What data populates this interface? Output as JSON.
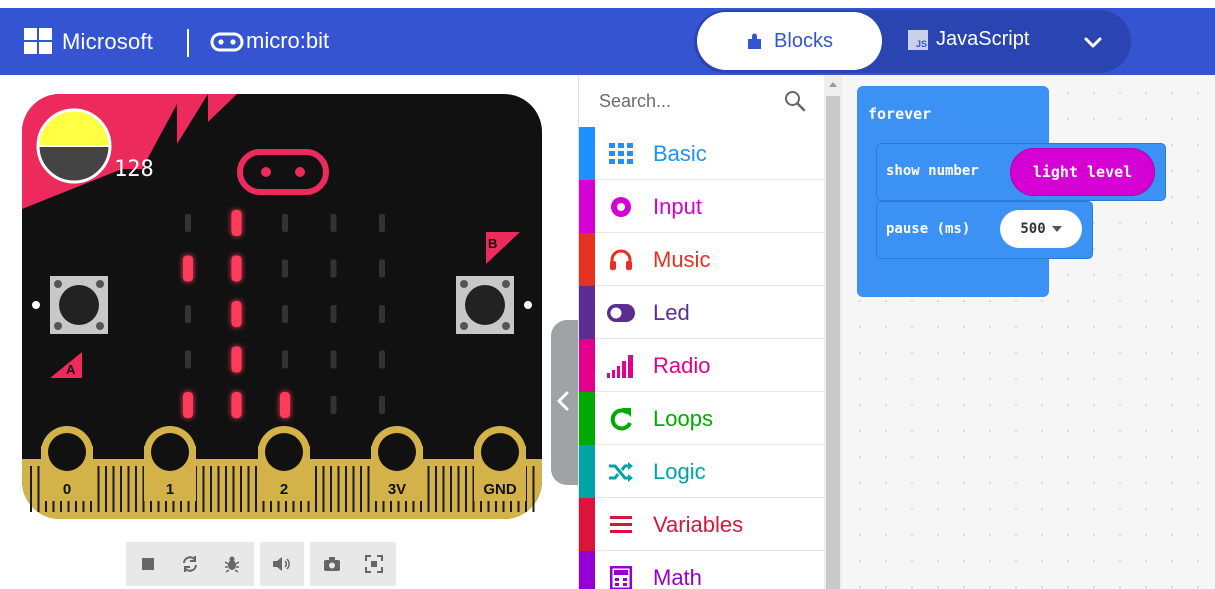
{
  "header": {
    "brand": "Microsoft",
    "product": "micro:bit",
    "tabs": [
      {
        "label": "Blocks",
        "active": true
      },
      {
        "label": "JavaScript",
        "active": false
      }
    ],
    "colors": {
      "bar": "#3454d1",
      "active_tab_text": "#3454d1"
    }
  },
  "simulator": {
    "light_level": "128",
    "light_level_fraction": 0.5,
    "button_a": "A",
    "button_b": "B",
    "pins": [
      "0",
      "1",
      "2",
      "3V",
      "GND"
    ],
    "led_matrix": [
      [
        0,
        1,
        0,
        0,
        0
      ],
      [
        1,
        1,
        0,
        0,
        0
      ],
      [
        0,
        1,
        0,
        0,
        0
      ],
      [
        0,
        1,
        0,
        0,
        0
      ],
      [
        1,
        1,
        1,
        0,
        0
      ]
    ],
    "toolbar_icons": [
      "stop-icon",
      "restart-icon",
      "debug-icon",
      "mute-icon",
      "screenshot-icon",
      "fullscreen-icon"
    ]
  },
  "toolbox": {
    "search_placeholder": "Search...",
    "categories": [
      {
        "label": "Basic",
        "color": "#1e90ff",
        "icon": "grid-icon"
      },
      {
        "label": "Input",
        "color": "#d400d4",
        "icon": "radio-circle-icon"
      },
      {
        "label": "Music",
        "color": "#e63022",
        "icon": "headphones-icon"
      },
      {
        "label": "Led",
        "color": "#5c2d91",
        "icon": "toggle-icon"
      },
      {
        "label": "Radio",
        "color": "#e3008c",
        "icon": "signal-bars-icon"
      },
      {
        "label": "Loops",
        "color": "#00aa00",
        "icon": "loop-arrow-icon"
      },
      {
        "label": "Logic",
        "color": "#00a4a6",
        "icon": "shuffle-icon"
      },
      {
        "label": "Variables",
        "color": "#dc143c",
        "icon": "list-lines-icon"
      },
      {
        "label": "Math",
        "color": "#9400d3",
        "icon": "calculator-icon"
      }
    ]
  },
  "workspace": {
    "forever_label": "forever",
    "show_number_label": "show number",
    "light_level_label": "light level",
    "pause_label": "pause (ms)",
    "pause_value": "500",
    "colors": {
      "basic": "#3c91f4",
      "input": "#d400d4"
    }
  }
}
